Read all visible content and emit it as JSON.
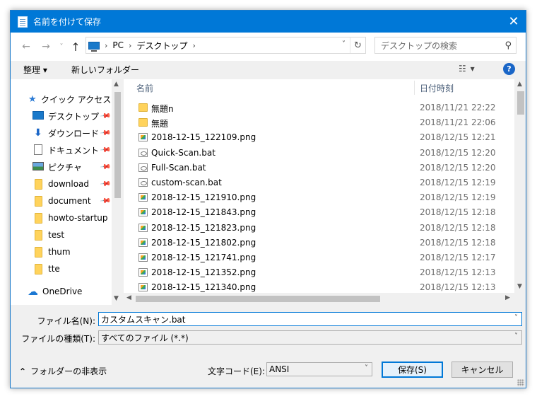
{
  "window": {
    "title": "名前を付けて保存",
    "close_glyph": "✕"
  },
  "address": {
    "back_glyph": "←",
    "forward_glyph": "→",
    "recent_glyph": "˅",
    "up_glyph": "↑",
    "crumbs": [
      "PC",
      "デスクトップ"
    ],
    "dropdown_glyph": "˅",
    "refresh_glyph": "↻",
    "search_placeholder": "デスクトップの検索",
    "search_icon_glyph": "⚲"
  },
  "toolbar": {
    "organize_label": "整理 ▾",
    "new_folder_label": "新しいフォルダー",
    "view_glyph": "☷  ▾",
    "help_glyph": "?"
  },
  "nav": {
    "quick_access": "クイック アクセス",
    "items": [
      {
        "label": "デスクトップ",
        "icon": "desktop-icon"
      },
      {
        "label": "ダウンロード",
        "icon": "download-arrow-icon"
      },
      {
        "label": "ドキュメント",
        "icon": "document-icon"
      },
      {
        "label": "ピクチャ",
        "icon": "pictures-icon"
      },
      {
        "label": "download",
        "icon": "folder-icon"
      },
      {
        "label": "document",
        "icon": "folder-icon"
      },
      {
        "label": "howto-startup",
        "icon": "folder-icon"
      },
      {
        "label": "test",
        "icon": "folder-icon"
      },
      {
        "label": "thum",
        "icon": "folder-icon"
      },
      {
        "label": "tte",
        "icon": "folder-icon"
      }
    ],
    "onedrive": "OneDrive",
    "pin_glyph": "📌"
  },
  "files": {
    "col_name": "名前",
    "col_date": "日付時刻",
    "sort_glyph": "˅",
    "rows": [
      {
        "name": "無題n",
        "date": "2018/11/21 22:22",
        "type": "folder"
      },
      {
        "name": "無題",
        "date": "2018/11/21 22:06",
        "type": "folder"
      },
      {
        "name": "2018-12-15_122109.png",
        "date": "2018/12/15 12:21",
        "type": "png"
      },
      {
        "name": "Quick-Scan.bat",
        "date": "2018/12/15 12:20",
        "type": "bat"
      },
      {
        "name": "Full-Scan.bat",
        "date": "2018/12/15 12:20",
        "type": "bat"
      },
      {
        "name": "custom-scan.bat",
        "date": "2018/12/15 12:19",
        "type": "bat"
      },
      {
        "name": "2018-12-15_121910.png",
        "date": "2018/12/15 12:19",
        "type": "png"
      },
      {
        "name": "2018-12-15_121843.png",
        "date": "2018/12/15 12:18",
        "type": "png"
      },
      {
        "name": "2018-12-15_121823.png",
        "date": "2018/12/15 12:18",
        "type": "png"
      },
      {
        "name": "2018-12-15_121802.png",
        "date": "2018/12/15 12:18",
        "type": "png"
      },
      {
        "name": "2018-12-15_121741.png",
        "date": "2018/12/15 12:17",
        "type": "png"
      },
      {
        "name": "2018-12-15_121352.png",
        "date": "2018/12/15 12:13",
        "type": "png"
      },
      {
        "name": "2018-12-15_121340.png",
        "date": "2018/12/15 12:13",
        "type": "png"
      }
    ]
  },
  "scroll": {
    "up": "▲",
    "down": "▼",
    "left": "◀",
    "right": "▶"
  },
  "save": {
    "filename_label": "ファイル名(N):",
    "filename_value": "カスタムスキャン.bat",
    "filetype_label": "ファイルの種類(T):",
    "filetype_value": "すべてのファイル  (*.*)",
    "encoding_label": "文字コード(E):",
    "encoding_value": "ANSI",
    "dd_glyph": "˅",
    "hide_folders_label": "フォルダーの非表示",
    "hide_glyph": "⌃",
    "save_button": "保存(S)",
    "cancel_button": "キャンセル"
  }
}
